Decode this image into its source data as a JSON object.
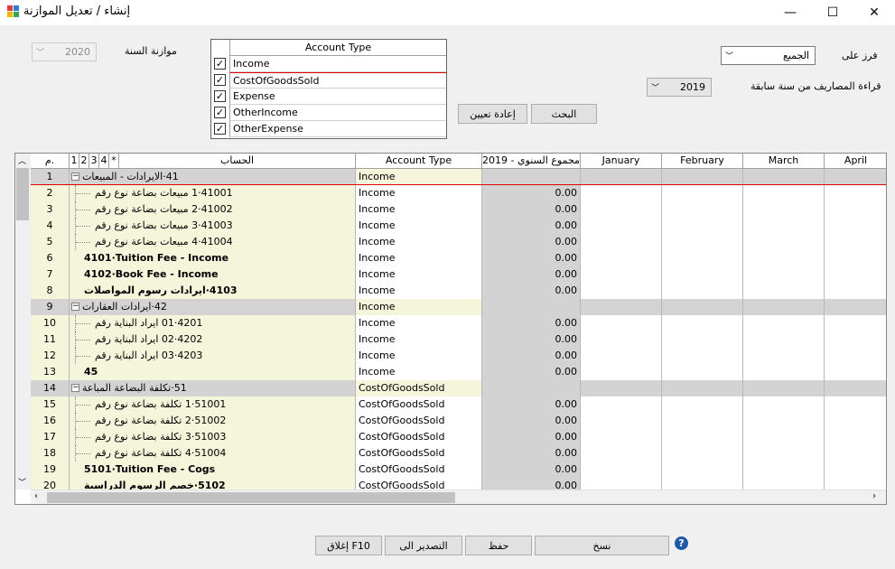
{
  "window": {
    "title": "إنشاء / تعديل الموازنة",
    "minimize": "—",
    "maximize": "☐",
    "close": "✕"
  },
  "filters": {
    "year_label": "موازنة السنة",
    "year_value": "2020",
    "sort_label": "فرز على",
    "sort_value": "الجميع",
    "prev_year_label": "قراءة المصاريف من سنة سابقة",
    "prev_year_value": "2019",
    "search_button": "البحث",
    "reset_button": "إعادة تعيين"
  },
  "account_type_list": {
    "header": "Account Type",
    "items": [
      {
        "label": "Income",
        "checked": true
      },
      {
        "label": "CostOfGoodsSold",
        "checked": true
      },
      {
        "label": "Expense",
        "checked": true
      },
      {
        "label": "OtherIncome",
        "checked": true
      },
      {
        "label": "OtherExpense",
        "checked": true
      }
    ]
  },
  "grid": {
    "headers": {
      "num": "م.",
      "level1": "1",
      "level2": "2",
      "level3": "3",
      "level4": "4",
      "star": "*",
      "account": "الحساب",
      "account_type": "Account Type",
      "annual": "مجموع السنوي - 2019",
      "m1": "January",
      "m2": "February",
      "m3": "March",
      "m4": "April"
    },
    "rows": [
      {
        "num": "1",
        "account": "41·الايرادات - المبيعات",
        "type": "Income",
        "annual": "",
        "level": 0,
        "group": true
      },
      {
        "num": "2",
        "account": "41001·1 مبيعات بضاعة نوع رقم",
        "type": "Income",
        "annual": "0.00",
        "level": 1
      },
      {
        "num": "3",
        "account": "41002·2 مبيعات بضاعة نوع رقم",
        "type": "Income",
        "annual": "0.00",
        "level": 1
      },
      {
        "num": "4",
        "account": "41003·3 مبيعات بضاعة نوع رقم",
        "type": "Income",
        "annual": "0.00",
        "level": 1
      },
      {
        "num": "5",
        "account": "41004·4 مبيعات بضاعة نوع رقم",
        "type": "Income",
        "annual": "0.00",
        "level": 1
      },
      {
        "num": "6",
        "account": "4101·Tuition Fee - Income",
        "type": "Income",
        "annual": "0.00",
        "level": 0,
        "bold": true
      },
      {
        "num": "7",
        "account": "4102·Book Fee - Income",
        "type": "Income",
        "annual": "0.00",
        "level": 0,
        "bold": true
      },
      {
        "num": "8",
        "account": "4103·ايرادات رسوم المواصلات",
        "type": "Income",
        "annual": "0.00",
        "level": 0,
        "bold": true
      },
      {
        "num": "9",
        "account": "42·ايرادات العقارات",
        "type": "Income",
        "annual": "",
        "level": 0,
        "group": true
      },
      {
        "num": "10",
        "account": "4201·01 ايراد البناية رقم",
        "type": "Income",
        "annual": "0.00",
        "level": 1
      },
      {
        "num": "11",
        "account": "4202·02 ايراد البناية رقم",
        "type": "Income",
        "annual": "0.00",
        "level": 1
      },
      {
        "num": "12",
        "account": "4203·03 ايراد البناية رقم",
        "type": "Income",
        "annual": "0.00",
        "level": 1
      },
      {
        "num": "13",
        "account": "45",
        "type": "Income",
        "annual": "0.00",
        "level": 0,
        "bold": true
      },
      {
        "num": "14",
        "account": "51·تكلفة البضاعة المباعة",
        "type": "CostOfGoodsSold",
        "annual": "",
        "level": 0,
        "group": true
      },
      {
        "num": "15",
        "account": "51001·1 تكلفة بضاعة نوع رقم",
        "type": "CostOfGoodsSold",
        "annual": "0.00",
        "level": 1
      },
      {
        "num": "16",
        "account": "51002·2 تكلفة بضاعة نوع رقم",
        "type": "CostOfGoodsSold",
        "annual": "0.00",
        "level": 1
      },
      {
        "num": "17",
        "account": "51003·3 تكلفة بضاعة نوع رقم",
        "type": "CostOfGoodsSold",
        "annual": "0.00",
        "level": 1
      },
      {
        "num": "18",
        "account": "51004·4 تكلفة بضاعة نوع رقم",
        "type": "CostOfGoodsSold",
        "annual": "0.00",
        "level": 1
      },
      {
        "num": "19",
        "account": "5101·Tuition Fee - Cogs",
        "type": "CostOfGoodsSold",
        "annual": "0.00",
        "level": 0,
        "bold": true
      },
      {
        "num": "20",
        "account": "5102·خصم الرسوم الدراسية",
        "type": "CostOfGoodsSold",
        "annual": "0.00",
        "level": 0,
        "bold": true
      }
    ]
  },
  "footer": {
    "copy_button": "نسخ",
    "save_button": "حفظ",
    "export_button": "التصدير الى",
    "close_button": "إغلاق F10"
  },
  "colors": {
    "beige": "#f5f5dc",
    "gray": "#d3d3d3",
    "selection_line": "#e00000",
    "help": "#1e5aa8"
  }
}
